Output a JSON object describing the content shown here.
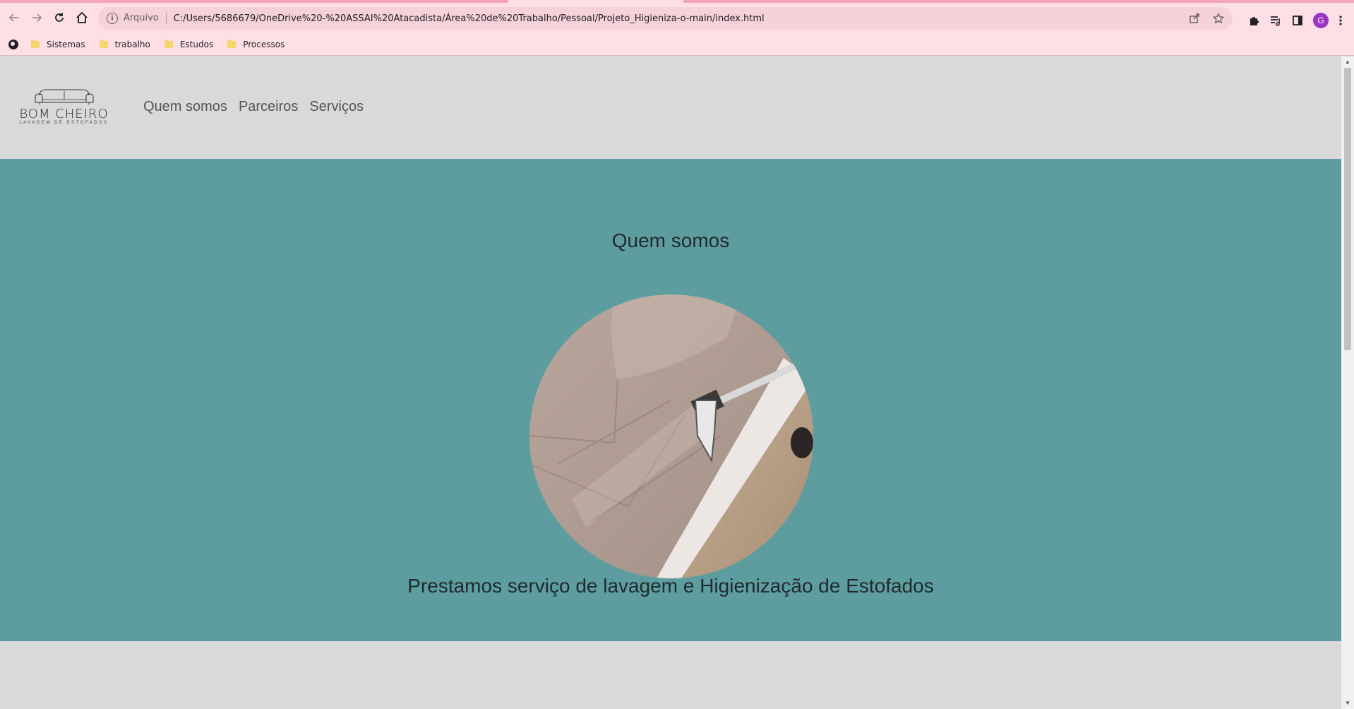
{
  "browser": {
    "back_icon": "arrow-left-icon",
    "forward_icon": "arrow-right-icon",
    "reload_icon": "reload-icon",
    "home_icon": "home-icon",
    "scheme_label": "Arquivo",
    "url": "C:/Users/5686679/OneDrive%20-%20ASSAI%20Atacadista/Área%20de%20Trabalho/Pessoal/Projeto_Higieniza-o-main/index.html",
    "avatar_letter": "G",
    "bookmarks": [
      {
        "label": "Sistemas"
      },
      {
        "label": "trabalho"
      },
      {
        "label": "Estudos"
      },
      {
        "label": "Processos"
      }
    ]
  },
  "site": {
    "logo_brand": "BOM CHEIRO",
    "logo_tagline": "LAVAGEM DE ESTOFADOS",
    "nav": [
      {
        "label": "Quem somos"
      },
      {
        "label": "Parceiros"
      },
      {
        "label": "Serviços"
      }
    ],
    "hero": {
      "title": "Quem somos",
      "description": "Prestamos serviço de lavagem e Higienização de Estofados",
      "background_color": "#5e9d9f"
    }
  },
  "colors": {
    "chrome_bg": "#ffdfe6",
    "page_bg": "#d9d9d9",
    "avatar_bg": "#9b35c4"
  }
}
